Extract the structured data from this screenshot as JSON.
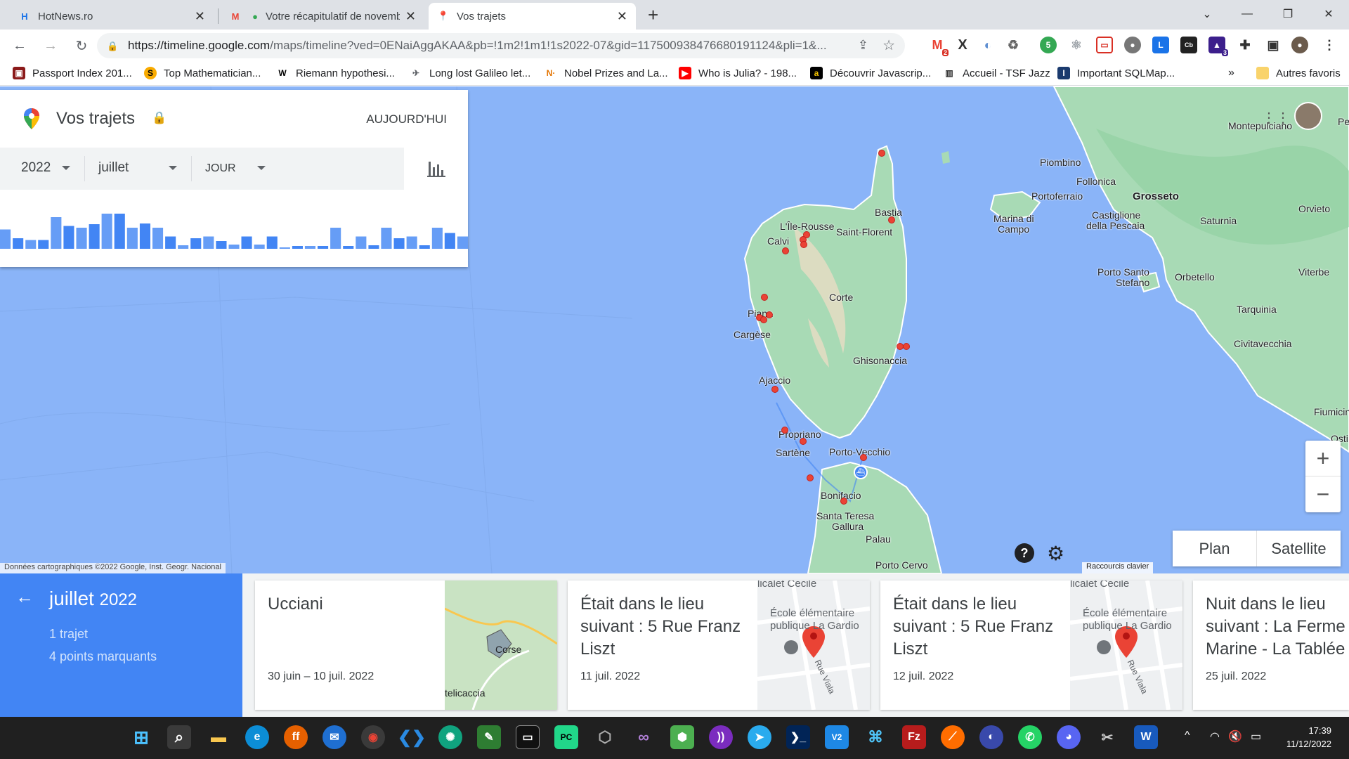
{
  "browser": {
    "tabs": [
      {
        "title": "HotNews.ro",
        "active": false
      },
      {
        "title": "Votre récapitulatif de novemb",
        "active": false
      },
      {
        "title": "Vos trajets",
        "active": true
      }
    ],
    "new_tab": "+",
    "url_host": "https://timeline.google.com",
    "url_rest": "/maps/timeline?ved=0ENaiAggAKAA&pb=!1m2!1m1!1s2022-07&gid=117500938476680191124&pli=1&...",
    "ext_badges": {
      "gmail": "2",
      "ext_blue": "3"
    },
    "bookmarks": [
      {
        "label": "Passport Index 201..."
      },
      {
        "label": "Top Mathematician..."
      },
      {
        "label": "Riemann hypothesi..."
      },
      {
        "label": "Long lost Galileo let..."
      },
      {
        "label": "Nobel Prizes and La..."
      },
      {
        "label": "Who is Julia? - 198..."
      },
      {
        "label": "Découvrir Javascrip..."
      },
      {
        "label": "Accueil - TSF Jazz"
      },
      {
        "label": "Important SQLMap..."
      }
    ],
    "bookmarks_overflow": "»",
    "other_bookmarks": "Autres favoris"
  },
  "panel": {
    "title": "Vos trajets",
    "today_button": "AUJOURD'HUI",
    "year": "2022",
    "month": "juillet",
    "period": "JOUR",
    "day_bars": [
      0.55,
      0.3,
      0.25,
      0.25,
      0.9,
      0.65,
      0.6,
      0.7,
      1.0,
      1.0,
      0.6,
      0.72,
      0.6,
      0.35,
      0.1,
      0.3,
      0.35,
      0.22,
      0.12,
      0.35,
      0.12,
      0.35,
      0.04,
      0.08,
      0.08,
      0.08,
      0.6,
      0.08,
      0.35,
      0.1,
      0.6,
      0.3,
      0.35,
      0.1,
      0.6,
      0.45,
      0.35
    ]
  },
  "map": {
    "places": [
      {
        "name": "Piombino"
      },
      {
        "name": "Follonica"
      },
      {
        "name": "Grosseto"
      },
      {
        "name": "Portoferraio"
      },
      {
        "name": "Marina di"
      },
      {
        "name": "Campo"
      },
      {
        "name": "Castiglione"
      },
      {
        "name": "della Pescaia"
      },
      {
        "name": "Saturnia"
      },
      {
        "name": "Orvieto"
      },
      {
        "name": "Montepulciano"
      },
      {
        "name": "Porto Santo"
      },
      {
        "name": "Stefano"
      },
      {
        "name": "Orbetello"
      },
      {
        "name": "Viterbe"
      },
      {
        "name": "Tarquinia"
      },
      {
        "name": "Civitavecchia"
      },
      {
        "name": "Fiumicin"
      },
      {
        "name": "Osti"
      },
      {
        "name": "Bastia"
      },
      {
        "name": "L'Île-Rousse"
      },
      {
        "name": "Saint-Florent"
      },
      {
        "name": "Calvi"
      },
      {
        "name": "Corte"
      },
      {
        "name": "Piana"
      },
      {
        "name": "Cargèse"
      },
      {
        "name": "Ghisonaccia"
      },
      {
        "name": "Ajaccio"
      },
      {
        "name": "Propriano"
      },
      {
        "name": "Sartène"
      },
      {
        "name": "Porto-Vecchio"
      },
      {
        "name": "Bonifacio"
      },
      {
        "name": "Santa Teresa"
      },
      {
        "name": "Gallura"
      },
      {
        "name": "Palau"
      },
      {
        "name": "Porto Cervo"
      },
      {
        "name": "Pe"
      }
    ],
    "zoom_in": "+",
    "zoom_out": "−",
    "type_plan": "Plan",
    "type_satellite": "Satellite",
    "attribution": "Données cartographiques ©2022 Google, Inst. Geogr. Nacional",
    "shortcuts": "Raccourcis clavier",
    "help": "?"
  },
  "summary": {
    "back": "←",
    "month": "juillet",
    "year": "2022",
    "trips": "1 trajet",
    "highlights": "4 points marquants"
  },
  "cards": [
    {
      "title": "Ucciani",
      "date": "30 juin – 10 juil. 2022",
      "thumb_labels": [
        "Corse",
        "telicaccia"
      ]
    },
    {
      "title": "Était dans le lieu suivant : 5 Rue Franz Liszt",
      "date": "11 juil. 2022",
      "thumb_labels": [
        "licalet Cecile",
        "École élémentaire",
        "publique La Gardio",
        "Rue Viala"
      ]
    },
    {
      "title": "Était dans le lieu suivant : 5 Rue Franz Liszt",
      "date": "12 juil. 2022",
      "thumb_labels": [
        "licalet Cecile",
        "École élémentaire",
        "publique La Gardio",
        "Rue Viala"
      ]
    },
    {
      "title": "Nuit dans le lieu suivant : La Ferme Marine - La Tablée",
      "date": "25 juil. 2022"
    }
  ],
  "clock": {
    "time": "17:39",
    "date": "11/12/2022"
  }
}
